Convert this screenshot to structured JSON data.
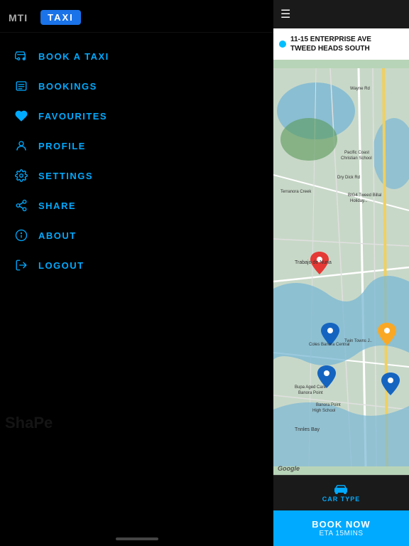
{
  "header": {
    "mti_label": "MTI",
    "taxi_label": "TAXI"
  },
  "nav": {
    "items": [
      {
        "id": "book-a-taxi",
        "label": "BOOK A TAXI",
        "icon": "taxi-icon"
      },
      {
        "id": "bookings",
        "label": "BOOKINGS",
        "icon": "list-icon"
      },
      {
        "id": "favourites",
        "label": "FAVOURITES",
        "icon": "heart-icon"
      },
      {
        "id": "profile",
        "label": "PROFILE",
        "icon": "person-icon"
      },
      {
        "id": "settings",
        "label": "SETTINGS",
        "icon": "gear-icon"
      },
      {
        "id": "share",
        "label": "SHARE",
        "icon": "share-icon"
      },
      {
        "id": "about",
        "label": "ABOUT",
        "icon": "info-icon"
      },
      {
        "id": "logout",
        "label": "LOGOUT",
        "icon": "logout-icon"
      }
    ]
  },
  "shape_text": "ShaPe",
  "map_panel": {
    "address_line1": "11-15 ENTERPRISE AVE",
    "address_line2": "TWEED HEADS SOUTH",
    "google_label": "Google",
    "car_type_label": "CAR TYPE",
    "book_now_label": "BOOK NOW",
    "eta_label": "ETA 15MINS"
  },
  "colors": {
    "accent": "#00aaff",
    "background": "#000000",
    "map_panel_bg": "#1a1a1a"
  }
}
